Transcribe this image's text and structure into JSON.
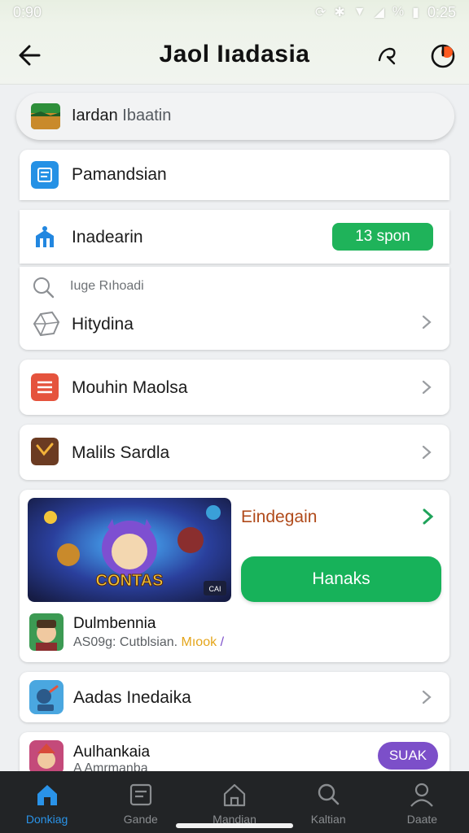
{
  "status_bar": {
    "time": "0:90",
    "battery_time": "0:25",
    "percent_glyph": "%"
  },
  "header": {
    "title": "Jaol Iıadasia",
    "back_icon": "back-arrow-icon",
    "action_icons": [
      "share-icon",
      "power-icon"
    ]
  },
  "search": {
    "label_a": "Iardan",
    "label_b": "Ibaatin"
  },
  "rows": {
    "pamandsian": {
      "label": "Pamandsian"
    },
    "inadearin": {
      "label": "Inadearin",
      "badge": "13 spon"
    },
    "search_hint": {
      "text": "Iuge Rıhoadi"
    },
    "hitydina": {
      "label": "Hitydina"
    },
    "mouhin": {
      "label": "Mouhin Maolsa"
    },
    "malils": {
      "label": "Malils Sardla"
    }
  },
  "promo": {
    "title": "Eindegain",
    "button": "Hanaks",
    "banner_text": "CONTAS",
    "banner_sub": "CAI",
    "game_name": "Dulmbennia",
    "game_meta_a": "AS09g: Cutblsian.",
    "game_meta_b": "Mıook",
    "game_meta_c": "/"
  },
  "rows2": {
    "aadas": {
      "label": "Aadas Inedaika"
    },
    "aulhankaia": {
      "label": "Aulhankaia",
      "sub": "A Amrmanba",
      "chip": "SUAK"
    }
  },
  "bottom_nav": [
    {
      "label": "Donkiag",
      "icon": "home-icon"
    },
    {
      "label": "Gande",
      "icon": "store-icon"
    },
    {
      "label": "Mandian",
      "icon": "house-outline-icon"
    },
    {
      "label": "Kaltian",
      "icon": "search-icon"
    },
    {
      "label": "Daate",
      "icon": "profile-icon"
    }
  ],
  "colors": {
    "accent_green": "#1fb35a",
    "brand_orange": "#ff5a1f",
    "nav_active": "#2a93e8",
    "chip_purple": "#7c4fc9",
    "promo_title": "#b04a1a"
  }
}
